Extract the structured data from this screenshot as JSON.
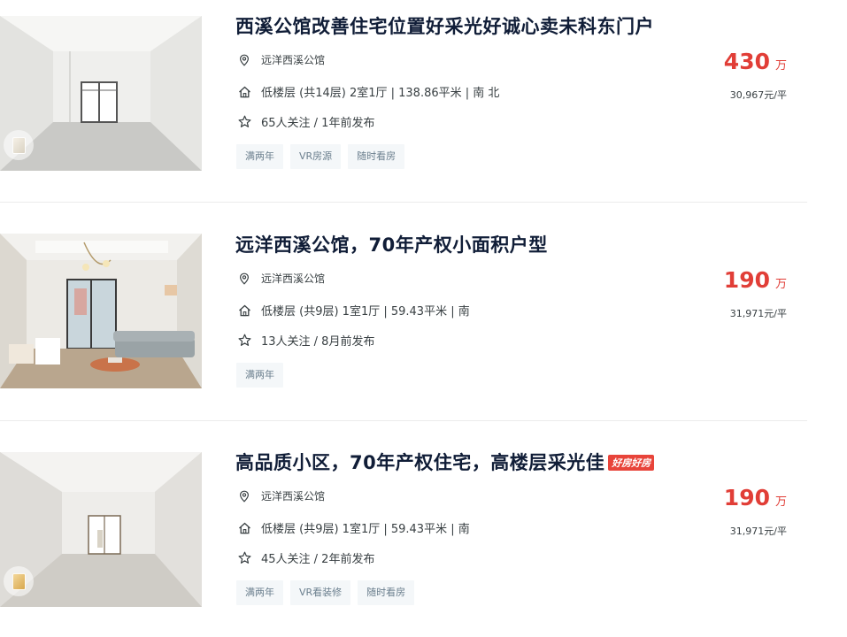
{
  "listings": [
    {
      "title": "西溪公馆改善住宅位置好采光好诚心卖未科东门户",
      "hot_tag": "",
      "community": "远洋西溪公馆",
      "house_info": "低楼层 (共14层) 2室1厅 | 138.86平米 | 南 北",
      "follow_info": "65人关注 / 1年前发布",
      "tags": [
        "满两年",
        "VR房源",
        "随时看房"
      ],
      "total_price": "430",
      "total_price_unit": "万",
      "unit_price": "30,967元/平"
    },
    {
      "title": "远洋西溪公馆，70年产权小面积户型",
      "hot_tag": "",
      "community": "远洋西溪公馆",
      "house_info": "低楼层 (共9层) 1室1厅 | 59.43平米 | 南",
      "follow_info": "13人关注 / 8月前发布",
      "tags": [
        "满两年"
      ],
      "total_price": "190",
      "total_price_unit": "万",
      "unit_price": "31,971元/平"
    },
    {
      "title": "高品质小区，70年产权住宅，高楼层采光佳",
      "hot_tag": "好房好房",
      "community": "远洋西溪公馆",
      "house_info": "低楼层 (共9层) 1室1厅 | 59.43平米 | 南",
      "follow_info": "45人关注 / 2年前发布",
      "tags": [
        "满两年",
        "VR看装修",
        "随时看房"
      ],
      "total_price": "190",
      "total_price_unit": "万",
      "unit_price": "31,971元/平"
    }
  ],
  "icons": {
    "location": "location-pin-icon",
    "house": "house-icon",
    "follow": "star-icon",
    "vr": "vr-cube-icon"
  },
  "colors": {
    "title": "#101d37",
    "price": "#e13e37",
    "tag_bg": "#f4f7f9",
    "tag_text": "#6b7f8e",
    "hot_tag_bg": "#e8443a"
  }
}
